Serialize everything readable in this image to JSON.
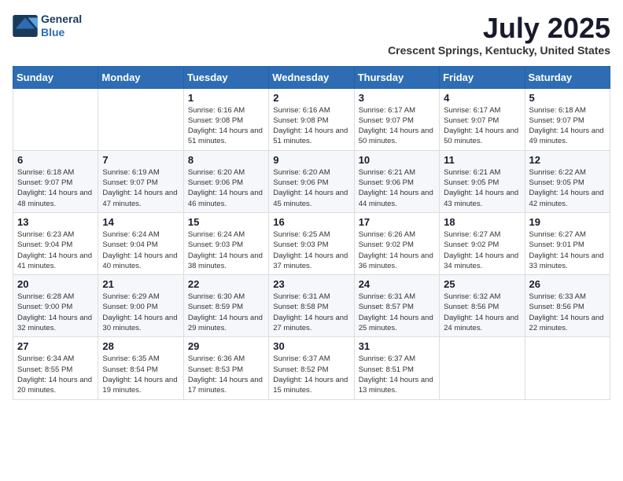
{
  "header": {
    "logo_line1": "General",
    "logo_line2": "Blue",
    "month": "July 2025",
    "location": "Crescent Springs, Kentucky, United States"
  },
  "weekdays": [
    "Sunday",
    "Monday",
    "Tuesday",
    "Wednesday",
    "Thursday",
    "Friday",
    "Saturday"
  ],
  "weeks": [
    [
      {
        "day": "",
        "info": ""
      },
      {
        "day": "",
        "info": ""
      },
      {
        "day": "1",
        "info": "Sunrise: 6:16 AM\nSunset: 9:08 PM\nDaylight: 14 hours and 51 minutes."
      },
      {
        "day": "2",
        "info": "Sunrise: 6:16 AM\nSunset: 9:08 PM\nDaylight: 14 hours and 51 minutes."
      },
      {
        "day": "3",
        "info": "Sunrise: 6:17 AM\nSunset: 9:07 PM\nDaylight: 14 hours and 50 minutes."
      },
      {
        "day": "4",
        "info": "Sunrise: 6:17 AM\nSunset: 9:07 PM\nDaylight: 14 hours and 50 minutes."
      },
      {
        "day": "5",
        "info": "Sunrise: 6:18 AM\nSunset: 9:07 PM\nDaylight: 14 hours and 49 minutes."
      }
    ],
    [
      {
        "day": "6",
        "info": "Sunrise: 6:18 AM\nSunset: 9:07 PM\nDaylight: 14 hours and 48 minutes."
      },
      {
        "day": "7",
        "info": "Sunrise: 6:19 AM\nSunset: 9:07 PM\nDaylight: 14 hours and 47 minutes."
      },
      {
        "day": "8",
        "info": "Sunrise: 6:20 AM\nSunset: 9:06 PM\nDaylight: 14 hours and 46 minutes."
      },
      {
        "day": "9",
        "info": "Sunrise: 6:20 AM\nSunset: 9:06 PM\nDaylight: 14 hours and 45 minutes."
      },
      {
        "day": "10",
        "info": "Sunrise: 6:21 AM\nSunset: 9:06 PM\nDaylight: 14 hours and 44 minutes."
      },
      {
        "day": "11",
        "info": "Sunrise: 6:21 AM\nSunset: 9:05 PM\nDaylight: 14 hours and 43 minutes."
      },
      {
        "day": "12",
        "info": "Sunrise: 6:22 AM\nSunset: 9:05 PM\nDaylight: 14 hours and 42 minutes."
      }
    ],
    [
      {
        "day": "13",
        "info": "Sunrise: 6:23 AM\nSunset: 9:04 PM\nDaylight: 14 hours and 41 minutes."
      },
      {
        "day": "14",
        "info": "Sunrise: 6:24 AM\nSunset: 9:04 PM\nDaylight: 14 hours and 40 minutes."
      },
      {
        "day": "15",
        "info": "Sunrise: 6:24 AM\nSunset: 9:03 PM\nDaylight: 14 hours and 38 minutes."
      },
      {
        "day": "16",
        "info": "Sunrise: 6:25 AM\nSunset: 9:03 PM\nDaylight: 14 hours and 37 minutes."
      },
      {
        "day": "17",
        "info": "Sunrise: 6:26 AM\nSunset: 9:02 PM\nDaylight: 14 hours and 36 minutes."
      },
      {
        "day": "18",
        "info": "Sunrise: 6:27 AM\nSunset: 9:02 PM\nDaylight: 14 hours and 34 minutes."
      },
      {
        "day": "19",
        "info": "Sunrise: 6:27 AM\nSunset: 9:01 PM\nDaylight: 14 hours and 33 minutes."
      }
    ],
    [
      {
        "day": "20",
        "info": "Sunrise: 6:28 AM\nSunset: 9:00 PM\nDaylight: 14 hours and 32 minutes."
      },
      {
        "day": "21",
        "info": "Sunrise: 6:29 AM\nSunset: 9:00 PM\nDaylight: 14 hours and 30 minutes."
      },
      {
        "day": "22",
        "info": "Sunrise: 6:30 AM\nSunset: 8:59 PM\nDaylight: 14 hours and 29 minutes."
      },
      {
        "day": "23",
        "info": "Sunrise: 6:31 AM\nSunset: 8:58 PM\nDaylight: 14 hours and 27 minutes."
      },
      {
        "day": "24",
        "info": "Sunrise: 6:31 AM\nSunset: 8:57 PM\nDaylight: 14 hours and 25 minutes."
      },
      {
        "day": "25",
        "info": "Sunrise: 6:32 AM\nSunset: 8:56 PM\nDaylight: 14 hours and 24 minutes."
      },
      {
        "day": "26",
        "info": "Sunrise: 6:33 AM\nSunset: 8:56 PM\nDaylight: 14 hours and 22 minutes."
      }
    ],
    [
      {
        "day": "27",
        "info": "Sunrise: 6:34 AM\nSunset: 8:55 PM\nDaylight: 14 hours and 20 minutes."
      },
      {
        "day": "28",
        "info": "Sunrise: 6:35 AM\nSunset: 8:54 PM\nDaylight: 14 hours and 19 minutes."
      },
      {
        "day": "29",
        "info": "Sunrise: 6:36 AM\nSunset: 8:53 PM\nDaylight: 14 hours and 17 minutes."
      },
      {
        "day": "30",
        "info": "Sunrise: 6:37 AM\nSunset: 8:52 PM\nDaylight: 14 hours and 15 minutes."
      },
      {
        "day": "31",
        "info": "Sunrise: 6:37 AM\nSunset: 8:51 PM\nDaylight: 14 hours and 13 minutes."
      },
      {
        "day": "",
        "info": ""
      },
      {
        "day": "",
        "info": ""
      }
    ]
  ]
}
